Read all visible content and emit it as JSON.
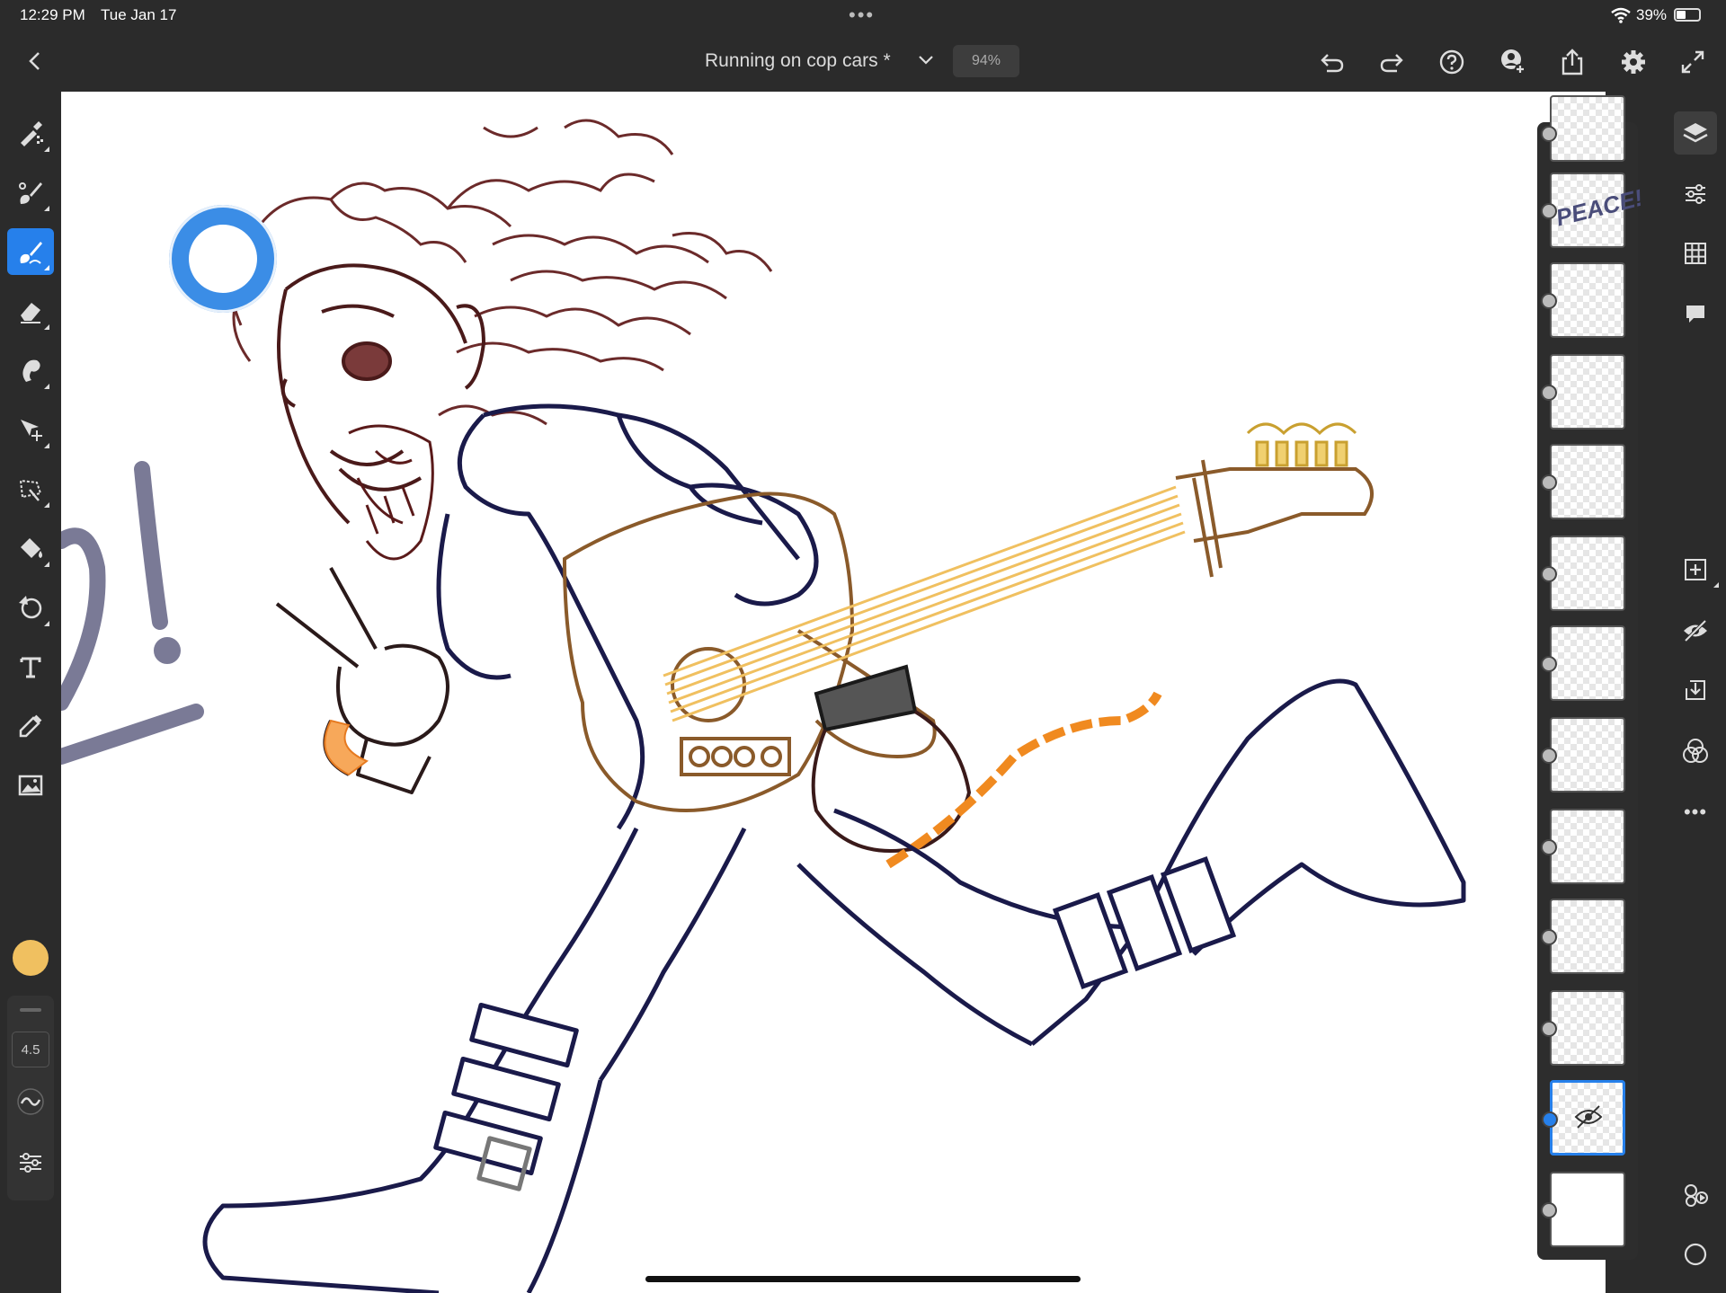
{
  "status_bar": {
    "time": "12:29 PM",
    "date": "Tue Jan 17",
    "battery": "39%"
  },
  "header": {
    "title": "Running on cop cars *",
    "zoom": "94%"
  },
  "left_toolbar": {
    "tools": [
      "pixel-brush",
      "live-brush",
      "vector-brush",
      "eraser",
      "smudge",
      "transform",
      "selection",
      "fill",
      "shape",
      "text",
      "eyedropper",
      "place-image"
    ],
    "active_tool": "vector-brush",
    "color": "#f0c060",
    "brush_size": "4.5"
  },
  "layers": {
    "thumbnail_text": "PEACE!",
    "count": 13,
    "selected_index": 11
  },
  "right_toolbar": {
    "tools": [
      "layers",
      "layer-properties",
      "grid",
      "comments",
      "add-layer",
      "hide-layer",
      "merge-down",
      "blend-mode",
      "more"
    ]
  }
}
